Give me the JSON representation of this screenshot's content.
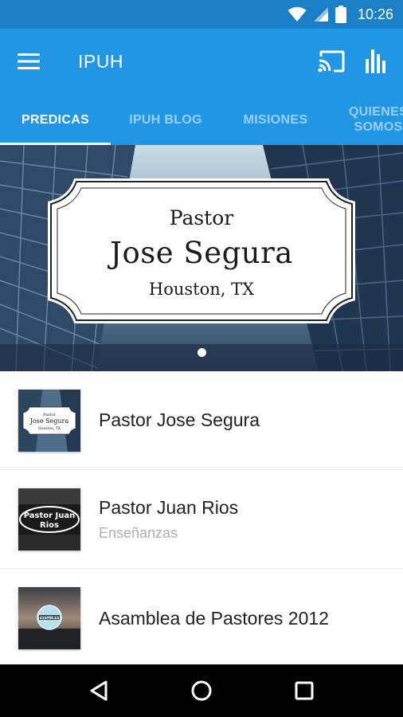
{
  "status_bar": {
    "time": "10:26",
    "icons": [
      "wifi-icon",
      "signal-icon",
      "battery-icon"
    ]
  },
  "app_bar": {
    "title": "IPUH",
    "icons": [
      "menu-icon",
      "cast-icon",
      "stats-icon"
    ]
  },
  "tabs": [
    {
      "label": "PREDICAS",
      "active": true
    },
    {
      "label": "IPUH BLOG",
      "active": false
    },
    {
      "label": "MISIONES",
      "active": false
    },
    {
      "label": "QUIENES\nSOMOS",
      "active": false
    }
  ],
  "hero": {
    "line1": "Pastor",
    "line2": "Jose Segura",
    "line3": "Houston, TX",
    "page_count": 1,
    "current_page": 1
  },
  "list": [
    {
      "title": "Pastor Jose Segura",
      "subtitle": "",
      "thumb_text": [
        "Pastor",
        "Jose Segura",
        "Houston, TX"
      ]
    },
    {
      "title": "Pastor Juan Rios",
      "subtitle": "Enseñanzas",
      "thumb_text": [
        "Pastor Juan",
        "Rios"
      ]
    },
    {
      "title": "Asamblea de Pastores 2012",
      "subtitle": "",
      "thumb_text": [
        "ASAMBLEA"
      ]
    }
  ],
  "nav_bar": {
    "icons": [
      "back-icon",
      "home-icon",
      "recents-icon"
    ]
  },
  "colors": {
    "primary": "#2196e5",
    "status": "#1a7fc4"
  }
}
